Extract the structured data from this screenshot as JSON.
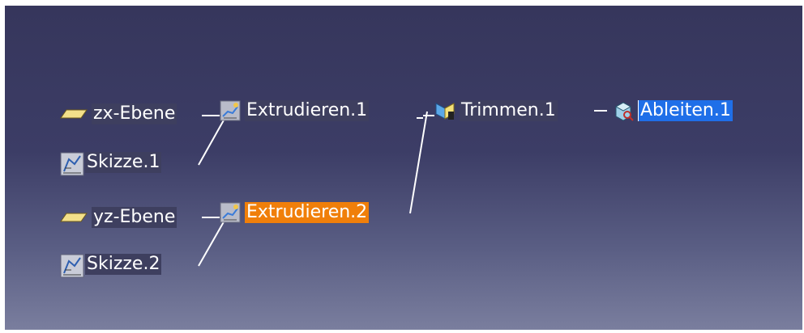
{
  "tree": {
    "zx_plane": {
      "label": "zx-Ebene",
      "icon": "plane-icon"
    },
    "sketch_1": {
      "label": "Skizze.1",
      "icon": "sketch-icon"
    },
    "extrude_1": {
      "label": "Extrudieren.1",
      "icon": "extrude-icon"
    },
    "trim_1": {
      "label": "Trimmen.1",
      "icon": "trim-icon"
    },
    "derive_1": {
      "label": "Ableiten.1",
      "icon": "derive-icon"
    },
    "yz_plane": {
      "label": "yz-Ebene",
      "icon": "plane-icon"
    },
    "extrude_2": {
      "label": "Extrudieren.2",
      "icon": "extrude-icon"
    },
    "sketch_2": {
      "label": "Skizze.2",
      "icon": "sketch-icon"
    }
  },
  "colors": {
    "background_top": "#36365c",
    "background_bottom": "#7a7e9e",
    "label_bg": "#3e3f5f",
    "highlight_orange": "#f07f0a",
    "selection_blue": "#1f6fe8",
    "link_line": "#ffffff"
  }
}
